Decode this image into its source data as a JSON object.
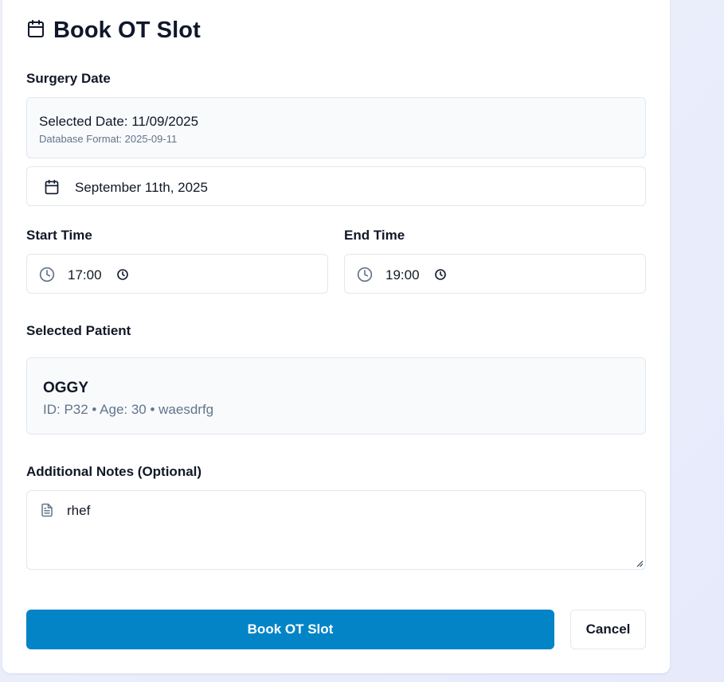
{
  "form": {
    "title": "Book OT Slot",
    "title_icon": "calendar-icon"
  },
  "surgery_date": {
    "label": "Surgery Date",
    "selected_text": "Selected Date: 11/09/2025",
    "db_format_text": "Database Format: 2025-09-11",
    "picker_value": "September 11th, 2025",
    "picker_icon": "calendar-icon"
  },
  "start_time": {
    "label": "Start Time",
    "value": "17:00",
    "icon": "clock-icon"
  },
  "end_time": {
    "label": "End Time",
    "value": "19:00",
    "icon": "clock-icon"
  },
  "patient": {
    "label": "Selected Patient",
    "name": "OGGY",
    "meta": "ID: P32 • Age: 30 • waesdrfg"
  },
  "notes": {
    "label": "Additional Notes (Optional)",
    "value": "rhef",
    "icon": "file-text-icon"
  },
  "actions": {
    "submit_label": "Book OT Slot",
    "cancel_label": "Cancel"
  },
  "colors": {
    "primary": "#0284c7",
    "muted_text": "#64748b",
    "border": "#e2e8f0",
    "muted_bg": "#f8fafc"
  }
}
